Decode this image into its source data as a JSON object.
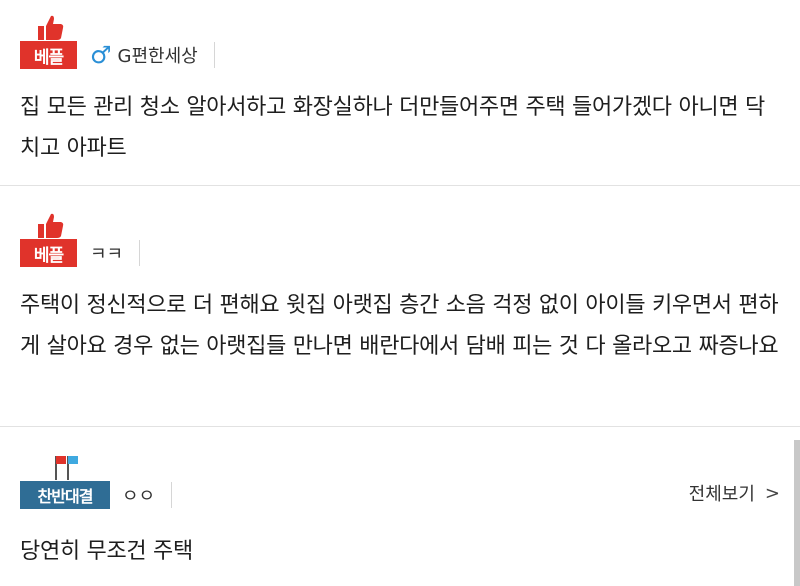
{
  "comments": [
    {
      "badge": "베플",
      "badge_icon": "thumbs-up-icon",
      "gender_icon": "male-symbol-icon",
      "author": "G편한세상",
      "text": "집 모든 관리 청소 알아서하고 화장실하나 더만들어주면 주택 들어가겠다 아니면 닥치고 아파트"
    },
    {
      "badge": "베플",
      "badge_icon": "thumbs-up-icon",
      "author": "ㅋㅋ",
      "text": "주택이 정신적으로 더 편해요 윗집 아랫집 층간 소음 걱정 없이 아이들 키우면서 편하게 살아요 경우 없는 아랫집들 만나면 배란다에서 담배 피는 것 다 올라오고 짜증나요"
    },
    {
      "badge": "찬반대결",
      "badge_icon": "flags-icon",
      "author": "ㅇㅇ",
      "see_all": "전체보기",
      "text": "당연히 무조건 주택"
    }
  ],
  "colors": {
    "best_badge": "#e0332b",
    "debate_badge": "#2f6d95",
    "male_icon": "#2a8fd6"
  }
}
